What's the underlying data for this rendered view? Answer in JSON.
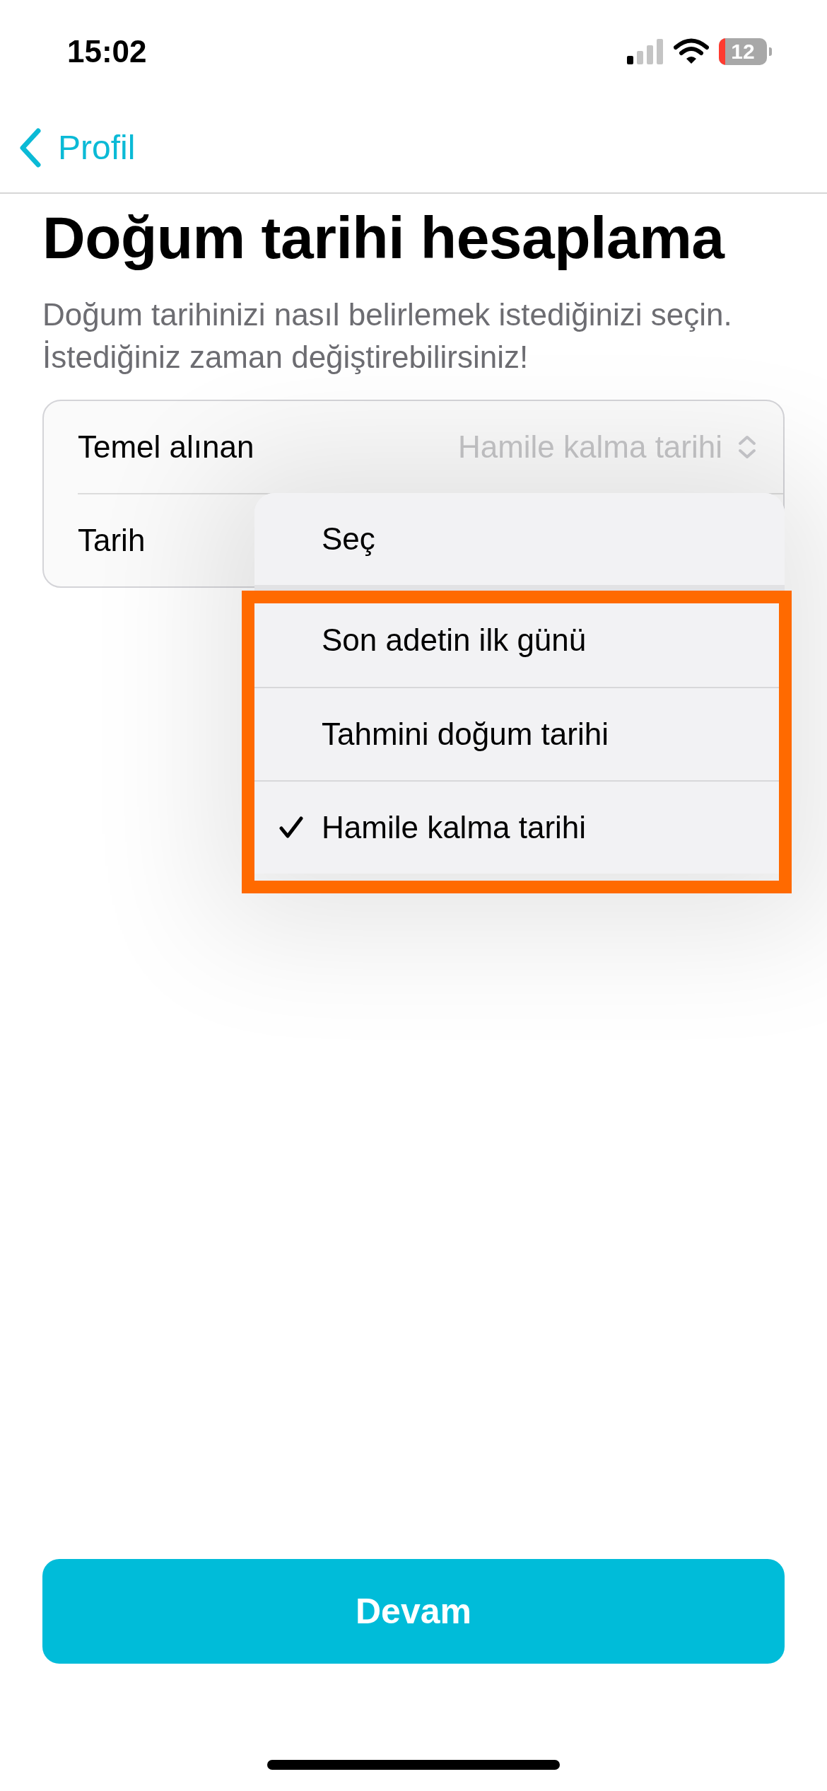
{
  "status_bar": {
    "time": "15:02",
    "battery": "12"
  },
  "nav": {
    "back_label": "Profil"
  },
  "title": "Doğum tarihi hesaplama",
  "subtitle": "Doğum tarihinizi nasıl belirlemek istediğinizi seçin. İstediğiniz zaman değiştirebilirsiniz!",
  "form": {
    "rows": [
      {
        "label": "Temel alınan",
        "value": "Hamile kalma tarihi"
      },
      {
        "label": "Tarih"
      }
    ]
  },
  "menu": {
    "top_item": {
      "label": "Seç"
    },
    "items": [
      {
        "label": "Son adetin ilk günü",
        "selected": false
      },
      {
        "label": "Tahmini doğum tarihi",
        "selected": false
      },
      {
        "label": "Hamile kalma tarihi",
        "selected": true
      }
    ]
  },
  "primary_button": "Devam"
}
